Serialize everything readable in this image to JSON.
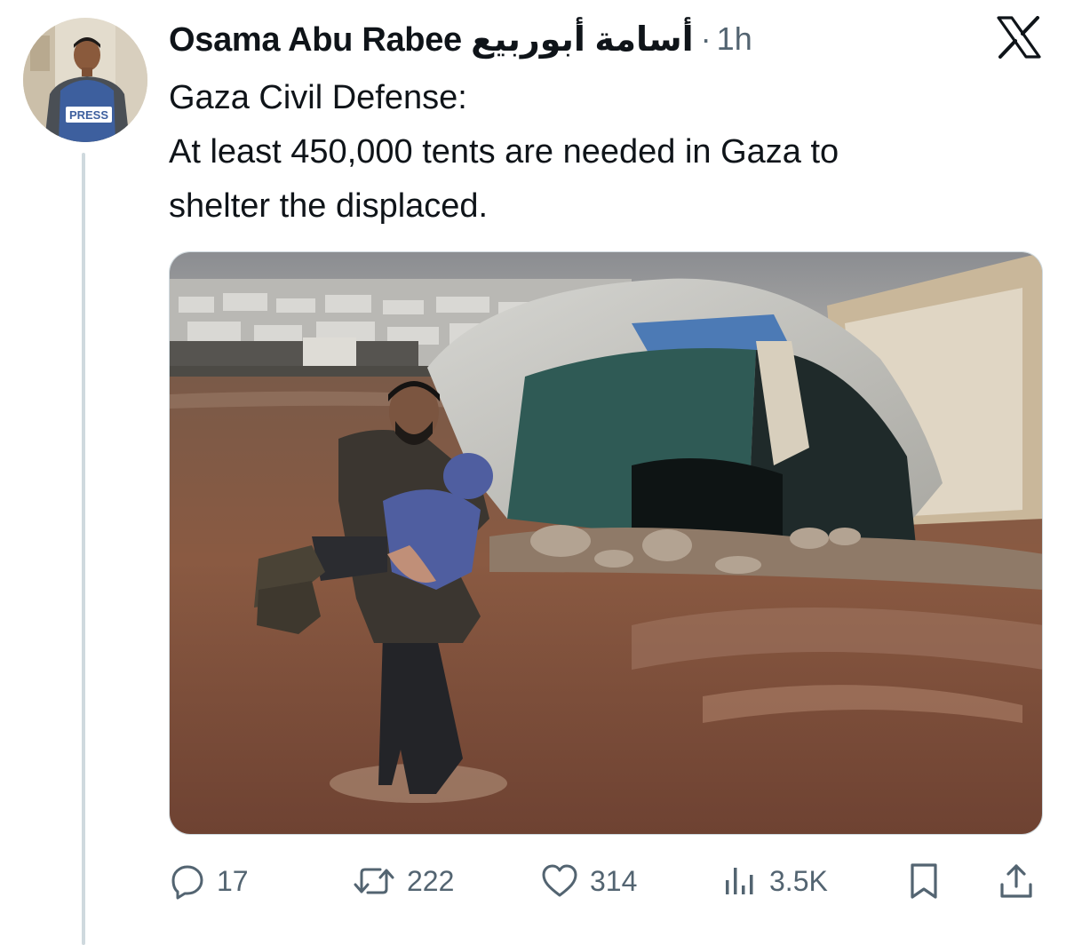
{
  "author": {
    "display_name": "Osama Abu Rabee",
    "display_name_arabic": "أسامة أبوربيع",
    "separator": "·",
    "time": "1h",
    "avatar_badge_text": "PRESS"
  },
  "platform_icon": "x-logo-icon",
  "tweet": {
    "lines": [
      "Gaza Civil Defense:",
      "At least 450,000 tents are needed in Gaza to",
      "shelter the displaced."
    ]
  },
  "media": {
    "type": "photo",
    "subject_icon": "photo-man-carrying-child-flooded-tent-camp"
  },
  "actions": {
    "reply": {
      "icon": "reply-icon",
      "count": "17"
    },
    "repost": {
      "icon": "repost-icon",
      "count": "222"
    },
    "like": {
      "icon": "heart-icon",
      "count": "314"
    },
    "views": {
      "icon": "views-icon",
      "count": "3.5K"
    },
    "bookmark": {
      "icon": "bookmark-icon"
    },
    "share": {
      "icon": "share-icon"
    }
  },
  "colors": {
    "text_primary": "#0f1419",
    "text_secondary": "#536471",
    "thread_line": "#cfd9de"
  }
}
